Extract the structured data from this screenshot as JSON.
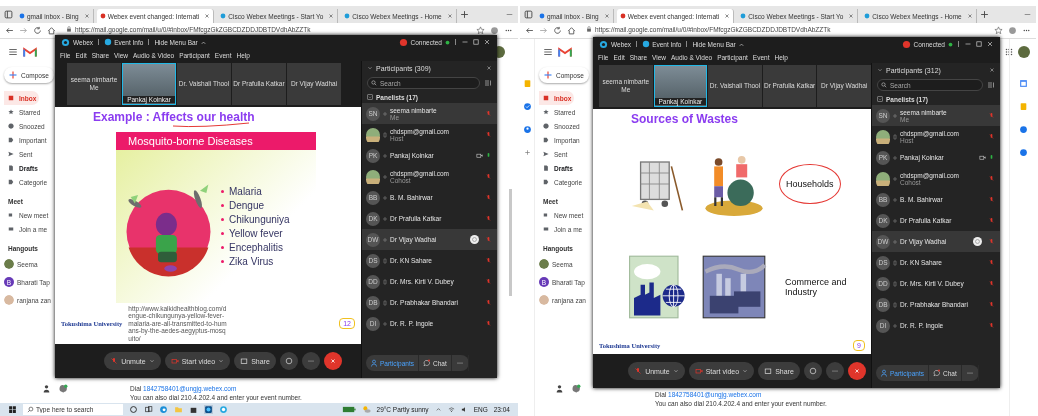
{
  "screens": [
    {
      "side_panel_open": false,
      "browser_tabs": [
        {
          "label": "gmail inbox - Bing",
          "selected": false
        },
        {
          "label": "Webex event changed: Internati",
          "selected": true
        },
        {
          "label": "Cisco Webex Meetings - Start Yo",
          "selected": false
        },
        {
          "label": "Cisco Webex Meetings - Home",
          "selected": false
        }
      ],
      "address": "https://mail.google.com/mail/u/0/#inbox/FMfcgzGkZGBCDZDDJDBTDVdhAbZZTk",
      "gmail": {
        "compose": "Compose",
        "nav": [
          {
            "label": "Inbox",
            "selected": true,
            "bold": false
          },
          {
            "label": "Starred",
            "selected": false,
            "bold": false
          },
          {
            "label": "Snoozed",
            "selected": false,
            "bold": false
          },
          {
            "label": "Important",
            "selected": false,
            "bold": false
          },
          {
            "label": "Sent",
            "selected": false,
            "bold": false
          },
          {
            "label": "Drafts",
            "selected": false,
            "bold": true
          },
          {
            "label": "Categorie",
            "selected": false,
            "bold": false
          }
        ],
        "meet_heading": "Meet",
        "meet": [
          "New meet",
          "Join a me"
        ],
        "hangouts_heading": "Hangouts",
        "contacts": [
          {
            "name": "Seema"
          },
          {
            "name": "Bharati Tap",
            "letter": "B"
          },
          {
            "name": "ranjana zan"
          }
        ],
        "dial_label": "Dial",
        "dial_link": "1842758401@ungjg.webex.com",
        "note": "You can also dial 210.4.202.4 and enter your event number."
      },
      "webex": {
        "app": "Webex",
        "event_info": "Event Info",
        "hide_menu": "Hide Menu Bar",
        "status": "Connected",
        "menu": [
          "File",
          "Edit",
          "Share",
          "View",
          "Audio & Video",
          "Participant",
          "Event",
          "Help"
        ],
        "thumbnails": [
          {
            "kind": "tile",
            "name": "seema nimbarte",
            "sub": "Me",
            "selected": false
          },
          {
            "kind": "video",
            "name": "Pankaj Koinkar",
            "selected": true
          },
          {
            "kind": "tile",
            "name": "Dr. Vaishali Thool",
            "selected": false
          },
          {
            "kind": "tile",
            "name": "Dr Prafulla Katkar",
            "selected": false
          },
          {
            "kind": "tile",
            "name": "Dr Vijay Wadhai",
            "selected": false
          }
        ],
        "slide": {
          "kind": "bullets",
          "title": "Example : Affects our health",
          "banner": "Mosquito-borne Diseases",
          "bullets": [
            "Malaria",
            "Dengue",
            "Chikunguniya",
            "Yellow fever",
            "Encephalitis",
            "Zika Virus"
          ],
          "source": "http://www.kalkidhealthblog.com/dengue-chikungunya-yellow-fever-malaria-are-all-transmitted-to-humans-by-the-aedes-aegyptus-mosquito/",
          "logo": "Tokushima University",
          "page": "12"
        },
        "toolbar": {
          "unmute": "Unmute",
          "video": "Start video",
          "share": "Share",
          "participants": "Participants",
          "chat": "Chat"
        },
        "panel": {
          "title": "Participants (309)",
          "search_placeholder": "Search",
          "group": "Panelists (17)",
          "people": [
            {
              "kind": "initials",
              "initials": "SN",
              "name": "seema nimbarte",
              "role": "Me",
              "phone": false,
              "video": false,
              "presenter": false,
              "muted": true,
              "selected": true
            },
            {
              "kind": "photo",
              "name": "chdspm@gmail.com",
              "role": "Host",
              "phone": true,
              "video": false,
              "presenter": false,
              "muted": true,
              "selected": false
            },
            {
              "kind": "initials",
              "initials": "PK",
              "name": "Pankaj Koinkar",
              "phone": false,
              "video": true,
              "presenter": false,
              "muted": false,
              "selected": false
            },
            {
              "kind": "photo",
              "name": "chdspm@gmail.com",
              "role": "Cohost",
              "phone": false,
              "video": false,
              "presenter": false,
              "muted": true,
              "selected": false
            },
            {
              "kind": "initials",
              "initials": "BB",
              "name": "B. M. Bahirwar",
              "phone": false,
              "video": false,
              "presenter": false,
              "muted": true,
              "selected": false
            },
            {
              "kind": "initials",
              "initials": "DK",
              "name": "Dr Prafulla Katkar",
              "phone": false,
              "video": false,
              "presenter": false,
              "muted": true,
              "selected": false
            },
            {
              "kind": "initials",
              "initials": "DW",
              "name": "Dr Vijay Wadhai",
              "phone": false,
              "video": false,
              "presenter": true,
              "muted": true,
              "selected": true
            },
            {
              "kind": "initials",
              "initials": "DS",
              "name": "Dr. KN Sahare",
              "phone": true,
              "video": false,
              "presenter": false,
              "muted": true,
              "selected": false
            },
            {
              "kind": "initials",
              "initials": "DD",
              "name": "Dr. Mrs. Kirti V. Dubey",
              "phone": true,
              "video": false,
              "presenter": false,
              "muted": true,
              "selected": false
            },
            {
              "kind": "initials",
              "initials": "DB",
              "name": "Dr. Prabhakar Bhandari",
              "phone": true,
              "video": false,
              "presenter": false,
              "muted": true,
              "selected": false
            },
            {
              "kind": "initials",
              "initials": "DI",
              "name": "Dr. R. P. Ingole",
              "phone": false,
              "video": false,
              "presenter": false,
              "muted": true,
              "selected": false
            }
          ]
        }
      },
      "taskbar": {
        "search_placeholder": "Type here to search",
        "weather": "29°C Partly sunny",
        "language": "ENG",
        "time": "23:04"
      }
    },
    {
      "side_panel_open": true,
      "browser_tabs": [
        {
          "label": "gmail inbox - Bing",
          "selected": false
        },
        {
          "label": "Webex event changed: Internati",
          "selected": true
        },
        {
          "label": "Cisco Webex Meetings - Start Yo",
          "selected": false
        },
        {
          "label": "Cisco Webex Meetings - Home",
          "selected": false
        }
      ],
      "address": "https://mail.google.com/mail/u/0/#inbox/FMfcgzGkZGBCDZDDJDBTDVdhAbZZTk",
      "gmail": {
        "compose": "Compose",
        "nav": [
          {
            "label": "Inbox",
            "selected": true,
            "bold": false
          },
          {
            "label": "Starred",
            "selected": false,
            "bold": false
          },
          {
            "label": "Snoozed",
            "selected": false,
            "bold": false
          },
          {
            "label": "Importan",
            "selected": false,
            "bold": false
          },
          {
            "label": "Sent",
            "selected": false,
            "bold": false
          },
          {
            "label": "Drafts",
            "selected": false,
            "bold": true
          },
          {
            "label": "Categorie",
            "selected": false,
            "bold": false
          }
        ],
        "meet_heading": "Meet",
        "meet": [
          "New meet",
          "Join a me"
        ],
        "hangouts_heading": "Hangouts",
        "contacts": [
          {
            "name": "Seema"
          },
          {
            "name": "Bharati Tap",
            "letter": "B"
          },
          {
            "name": "ranjana zan"
          }
        ],
        "dial_label": "Dial",
        "dial_link": "1842758401@ungjg.webex.com",
        "note": "You can also dial 210.4.202.4 and enter your event number."
      },
      "webex": {
        "app": "Webex",
        "event_info": "Event Info",
        "hide_menu": "Hide Menu Bar",
        "status": "Connected",
        "menu": [
          "File",
          "Edit",
          "Share",
          "View",
          "Audio & Video",
          "Participant",
          "Event",
          "Help"
        ],
        "thumbnails": [
          {
            "kind": "tile",
            "name": "seema nimbarte",
            "sub": "Me",
            "selected": false
          },
          {
            "kind": "video",
            "name": "Pankaj Koinkar",
            "selected": true
          },
          {
            "kind": "tile",
            "name": "Dr. Vaishali Thool",
            "selected": false
          },
          {
            "kind": "tile",
            "name": "Dr Prafulla Katkar",
            "selected": false
          },
          {
            "kind": "tile",
            "name": "Dr Vijay Wadhai",
            "selected": false
          }
        ],
        "slide": {
          "kind": "grid",
          "title": "Sources of Wastes",
          "rows": [
            {
              "label": "Households",
              "circled": true
            },
            {
              "label": "Commerce and Industry",
              "circled": false
            }
          ],
          "logo": "Tokushima University",
          "page": "9"
        },
        "toolbar": {
          "unmute": "Unmute",
          "video": "Start video",
          "share": "Share",
          "participants": "Participants",
          "chat": "Chat"
        },
        "panel": {
          "title": "Participants (312)",
          "search_placeholder": "Search",
          "group": "Panelists (17)",
          "people": [
            {
              "kind": "initials",
              "initials": "SN",
              "name": "seema nimbarte",
              "role": "Me",
              "phone": false,
              "video": false,
              "presenter": false,
              "muted": true,
              "selected": true
            },
            {
              "kind": "photo",
              "name": "chdspm@gmail.com",
              "role": "Host",
              "phone": true,
              "video": false,
              "presenter": false,
              "muted": true,
              "selected": false
            },
            {
              "kind": "initials",
              "initials": "PK",
              "name": "Pankaj Koinkar",
              "phone": false,
              "video": true,
              "presenter": false,
              "muted": false,
              "selected": false
            },
            {
              "kind": "photo",
              "name": "chdspm@gmail.com",
              "role": "Cohost",
              "phone": false,
              "video": false,
              "presenter": false,
              "muted": true,
              "selected": false
            },
            {
              "kind": "initials",
              "initials": "BB",
              "name": "B. M. Bahirwar",
              "phone": false,
              "video": false,
              "presenter": false,
              "muted": true,
              "selected": false
            },
            {
              "kind": "initials",
              "initials": "DK",
              "name": "Dr Prafulla Katkar",
              "phone": false,
              "video": false,
              "presenter": false,
              "muted": true,
              "selected": false
            },
            {
              "kind": "initials",
              "initials": "DW",
              "name": "Dr Vijay Wadhai",
              "phone": false,
              "video": false,
              "presenter": true,
              "muted": true,
              "selected": true
            },
            {
              "kind": "initials",
              "initials": "DS",
              "name": "Dr. KN Sahare",
              "phone": true,
              "video": false,
              "presenter": false,
              "muted": true,
              "selected": false
            },
            {
              "kind": "initials",
              "initials": "DD",
              "name": "Dr. Mrs. Kirti V. Dubey",
              "phone": true,
              "video": false,
              "presenter": false,
              "muted": true,
              "selected": false
            },
            {
              "kind": "initials",
              "initials": "DB",
              "name": "Dr. Prabhakar Bhandari",
              "phone": true,
              "video": false,
              "presenter": false,
              "muted": true,
              "selected": false
            },
            {
              "kind": "initials",
              "initials": "DI",
              "name": "Dr. R. P. Ingole",
              "phone": false,
              "video": false,
              "presenter": false,
              "muted": true,
              "selected": false
            }
          ]
        }
      }
    }
  ]
}
